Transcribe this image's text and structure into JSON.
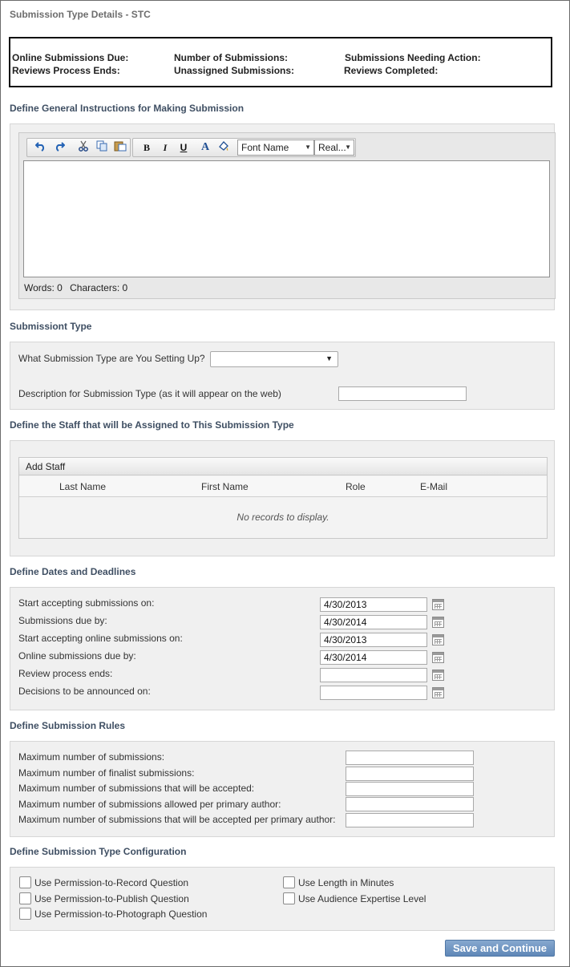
{
  "page": {
    "title": "Submission Type Details - STC"
  },
  "summary": {
    "online_due": "Online Submissions Due:",
    "number_submissions": "Number of Submissions:",
    "needing_action": "Submissions Needing Action:",
    "reviews_ends": "Reviews Process Ends:",
    "unassigned": "Unassigned Submissions:",
    "reviews_completed": "Reviews Completed:"
  },
  "instructions": {
    "heading": "Define General Instructions for Making Submission",
    "toolbar": {
      "undo_icon": "undo-icon",
      "redo_icon": "redo-icon",
      "cut_icon": "cut-icon",
      "copy_icon": "copy-icon",
      "paste_icon": "paste-icon",
      "bold_label": "B",
      "italic_label": "I",
      "underline_label": "U",
      "font_color_label": "A",
      "font_name": "Font Name",
      "font_size": "Real..."
    },
    "words": "Words: 0",
    "characters": "Characters: 0"
  },
  "submission_type": {
    "heading": "Submissiont Type",
    "question": "What Submission Type are You Setting Up?",
    "selected": "",
    "description_label": "Description for Submission Type (as it will appear on the web)",
    "description_value": ""
  },
  "staff": {
    "heading": "Define the Staff that will be Assigned to This Submission Type",
    "add_staff": "Add Staff",
    "columns": [
      "Last Name",
      "First Name",
      "Role",
      "E-Mail"
    ],
    "no_records": "No records to display."
  },
  "dates": {
    "heading": "Define Dates and Deadlines",
    "rows": [
      {
        "label": "Start accepting submissions on:",
        "value": "4/30/2013"
      },
      {
        "label": "Submissions due by:",
        "value": "4/30/2014"
      },
      {
        "label": "Start accepting online submissions on:",
        "value": "4/30/2013"
      },
      {
        "label": "Online submissions due by:",
        "value": "4/30/2014"
      },
      {
        "label": "Review process ends:",
        "value": ""
      },
      {
        "label": "Decisions to be announced on:",
        "value": ""
      }
    ]
  },
  "rules": {
    "heading": "Define Submission Rules",
    "rows": [
      {
        "label": "Maximum number of submissions:",
        "value": ""
      },
      {
        "label": "Maximum number of finalist submissions:",
        "value": ""
      },
      {
        "label": "Maximum number of submissions that will be accepted:",
        "value": ""
      },
      {
        "label": "Maximum number of submissions allowed per primary author:",
        "value": ""
      },
      {
        "label": "Maximum number of submissions that will be accepted per primary author:",
        "value": ""
      }
    ]
  },
  "config": {
    "heading": "Define Submission Type Configuration",
    "options": [
      {
        "label": "Use Permission-to-Record Question",
        "checked": false
      },
      {
        "label": "Use Permission-to-Publish Question",
        "checked": false
      },
      {
        "label": "Use Permission-to-Photograph Question",
        "checked": false
      },
      {
        "label": "Use Length in Minutes",
        "checked": false
      },
      {
        "label": "Use Audience Expertise Level",
        "checked": false
      }
    ]
  },
  "actions": {
    "save_continue": "Save and Continue"
  },
  "colors": {
    "heading": "#3f4f63",
    "button": "#6f95c2",
    "panel": "#f0f0f0"
  }
}
